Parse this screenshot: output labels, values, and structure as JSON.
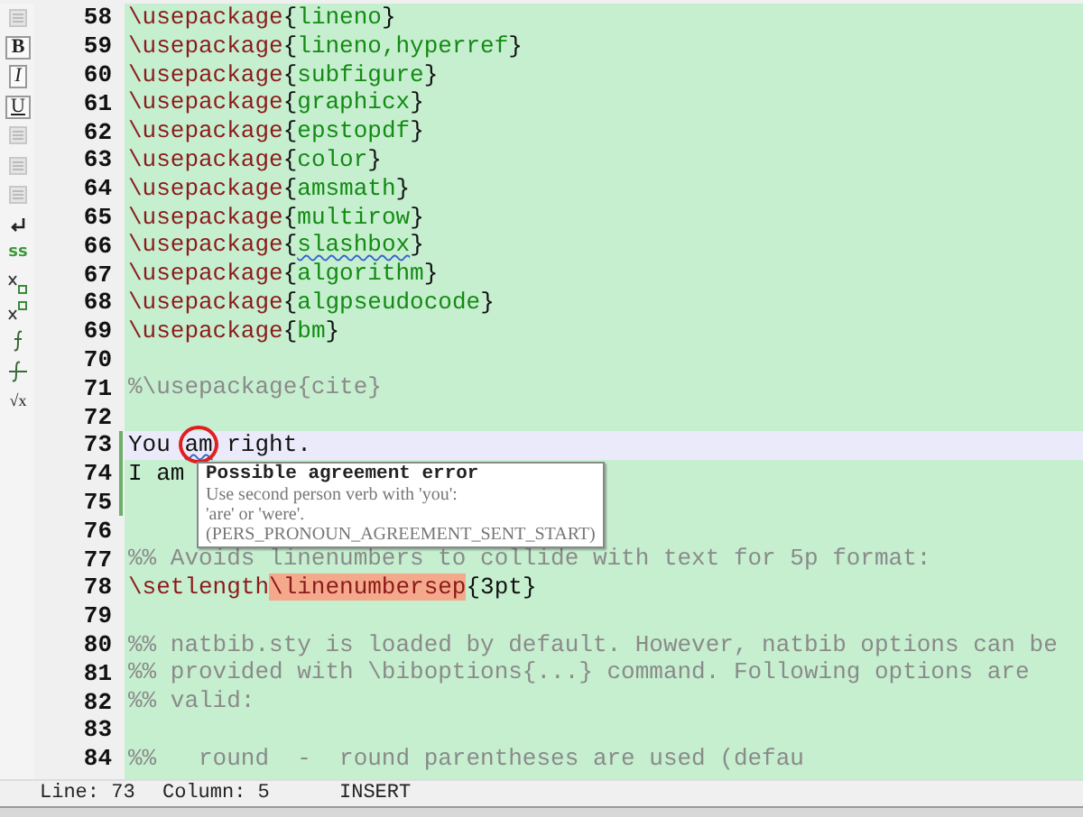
{
  "toolbar": [
    {
      "kind": "faded"
    },
    {
      "kind": "bold",
      "label": "B"
    },
    {
      "kind": "italic",
      "label": "I"
    },
    {
      "kind": "underline",
      "label": "U"
    },
    {
      "kind": "faded"
    },
    {
      "kind": "faded"
    },
    {
      "kind": "faded"
    },
    {
      "kind": "return"
    },
    {
      "kind": "green",
      "label": "ss"
    },
    {
      "kind": "subscript"
    },
    {
      "kind": "superscript"
    },
    {
      "kind": "integral"
    },
    {
      "kind": "strike"
    },
    {
      "kind": "small",
      "label": "√x"
    }
  ],
  "lines": [
    {
      "number": "58",
      "segments": [
        {
          "kind": "cmd",
          "text": "\\usepackage"
        },
        {
          "kind": "brace",
          "text": "{"
        },
        {
          "kind": "arg",
          "text": "lineno"
        },
        {
          "kind": "brace",
          "text": "}"
        }
      ]
    },
    {
      "number": "59",
      "segments": [
        {
          "kind": "cmd",
          "text": "\\usepackage"
        },
        {
          "kind": "brace",
          "text": "{"
        },
        {
          "kind": "arg",
          "text": "lineno,hyperref"
        },
        {
          "kind": "brace",
          "text": "}"
        }
      ]
    },
    {
      "number": "60",
      "segments": [
        {
          "kind": "cmd",
          "text": "\\usepackage"
        },
        {
          "kind": "brace",
          "text": "{"
        },
        {
          "kind": "arg",
          "text": "subfigure"
        },
        {
          "kind": "brace",
          "text": "}"
        }
      ]
    },
    {
      "number": "61",
      "segments": [
        {
          "kind": "cmd",
          "text": "\\usepackage"
        },
        {
          "kind": "brace",
          "text": "{"
        },
        {
          "kind": "arg",
          "text": "graphicx"
        },
        {
          "kind": "brace",
          "text": "}"
        }
      ]
    },
    {
      "number": "62",
      "segments": [
        {
          "kind": "cmd",
          "text": "\\usepackage"
        },
        {
          "kind": "brace",
          "text": "{"
        },
        {
          "kind": "arg",
          "text": "epstopdf"
        },
        {
          "kind": "brace",
          "text": "}"
        }
      ]
    },
    {
      "number": "63",
      "segments": [
        {
          "kind": "cmd",
          "text": "\\usepackage"
        },
        {
          "kind": "brace",
          "text": "{"
        },
        {
          "kind": "arg",
          "text": "color"
        },
        {
          "kind": "brace",
          "text": "}"
        }
      ]
    },
    {
      "number": "64",
      "segments": [
        {
          "kind": "cmd",
          "text": "\\usepackage"
        },
        {
          "kind": "brace",
          "text": "{"
        },
        {
          "kind": "arg",
          "text": "amsmath"
        },
        {
          "kind": "brace",
          "text": "}"
        }
      ]
    },
    {
      "number": "65",
      "segments": [
        {
          "kind": "cmd",
          "text": "\\usepackage"
        },
        {
          "kind": "brace",
          "text": "{"
        },
        {
          "kind": "arg",
          "text": "multirow"
        },
        {
          "kind": "brace",
          "text": "}"
        }
      ]
    },
    {
      "number": "66",
      "segments": [
        {
          "kind": "cmd",
          "text": "\\usepackage"
        },
        {
          "kind": "brace",
          "text": "{"
        },
        {
          "kind": "arg",
          "text": "slashbox",
          "squiggle": true
        },
        {
          "kind": "brace",
          "text": "}"
        }
      ]
    },
    {
      "number": "67",
      "segments": [
        {
          "kind": "cmd",
          "text": "\\usepackage"
        },
        {
          "kind": "brace",
          "text": "{"
        },
        {
          "kind": "arg",
          "text": "algorithm"
        },
        {
          "kind": "brace",
          "text": "}"
        }
      ]
    },
    {
      "number": "68",
      "segments": [
        {
          "kind": "cmd",
          "text": "\\usepackage"
        },
        {
          "kind": "brace",
          "text": "{"
        },
        {
          "kind": "arg",
          "text": "algpseudocode"
        },
        {
          "kind": "brace",
          "text": "}"
        }
      ]
    },
    {
      "number": "69",
      "segments": [
        {
          "kind": "cmd",
          "text": "\\usepackage"
        },
        {
          "kind": "brace",
          "text": "{"
        },
        {
          "kind": "arg",
          "text": "bm"
        },
        {
          "kind": "brace",
          "text": "}"
        }
      ]
    },
    {
      "number": "70"
    },
    {
      "number": "71",
      "segments": [
        {
          "kind": "comment",
          "text": "%\\usepackage{cite}"
        }
      ]
    },
    {
      "number": "72"
    },
    {
      "number": "73",
      "current": true,
      "changed": true,
      "segments": [
        {
          "kind": "text",
          "text": "You "
        },
        {
          "kind": "text",
          "text": "am",
          "squiggle": true,
          "circled": true
        },
        {
          "kind": "text",
          "text": " right."
        }
      ]
    },
    {
      "number": "74",
      "changed": true,
      "segments": [
        {
          "kind": "text",
          "text": "I am"
        }
      ]
    },
    {
      "number": "75",
      "changed": true
    },
    {
      "number": "76"
    },
    {
      "number": "77",
      "segments": [
        {
          "kind": "comment",
          "text": "%% Avoids linenumbers to collide with text for 5p format:"
        }
      ]
    },
    {
      "number": "78",
      "segments": [
        {
          "kind": "cmd",
          "text": "\\setlength"
        },
        {
          "kind": "cmd",
          "text": "\\linenumbersep",
          "highlight": true
        },
        {
          "kind": "brace",
          "text": "{3pt}"
        }
      ]
    },
    {
      "number": "79"
    },
    {
      "number": "80",
      "segments": [
        {
          "kind": "comment",
          "text": "%% natbib.sty is loaded by default. However, natbib options can be"
        }
      ]
    },
    {
      "number": "81",
      "segments": [
        {
          "kind": "comment",
          "text": "%% provided with \\biboptions{...} command. Following options are"
        }
      ]
    },
    {
      "number": "82",
      "segments": [
        {
          "kind": "comment",
          "text": "%% valid:"
        }
      ]
    },
    {
      "number": "83"
    },
    {
      "number": "84",
      "segments": [
        {
          "kind": "comment",
          "text": "%%   round  -  round parentheses are used (defau"
        }
      ]
    }
  ],
  "tooltip": {
    "title": "Possible agreement error",
    "lines": [
      "Use second person verb with 'you':",
      "'are' or 'were'.",
      "(PERS_PRONOUN_AGREEMENT_SENT_START)"
    ]
  },
  "status_bar": {
    "line": "Line: 73",
    "column": "Column: 5",
    "mode": "INSERT"
  }
}
